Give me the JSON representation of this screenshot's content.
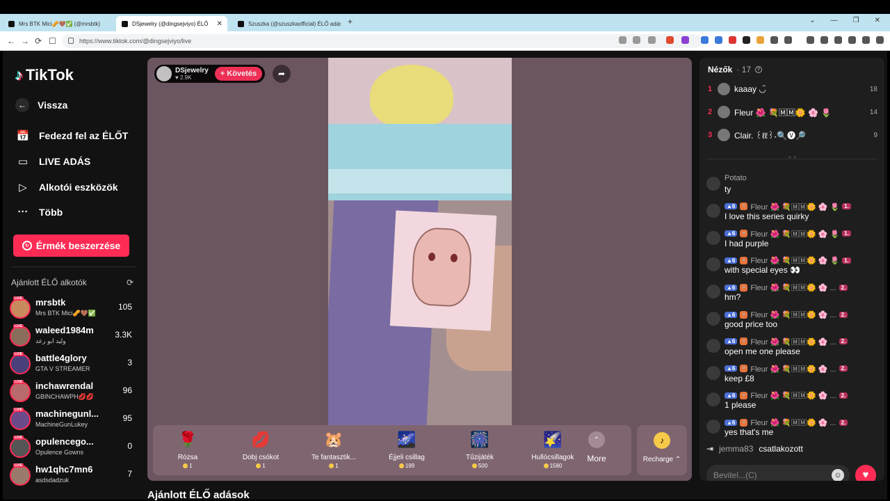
{
  "browser": {
    "tabs": [
      {
        "title": "Mrs BTK Mici🥜🤎✅ (@mrsbtk)"
      },
      {
        "title": "DSjewelry (@dingsejviyo) ÉLŐ",
        "active": true
      },
      {
        "title": "Szuszka (@szuszkaofficial) ÉLŐ adás"
      }
    ],
    "new_tab": "+",
    "url": "https://www.tiktok.com/@dingsejviyo/live"
  },
  "sidebar": {
    "logo": "TikTok",
    "back": "Vissza",
    "nav": [
      {
        "label": "Fedezd fel az ÉLŐT",
        "icon": "calendar-live-icon"
      },
      {
        "label": "LIVE ADÁS",
        "icon": "camera-icon"
      },
      {
        "label": "Alkotói eszközök",
        "icon": "play-box-icon"
      },
      {
        "label": "Több",
        "icon": "more-dots-icon"
      }
    ],
    "coins_button": "Érmék beszerzése",
    "recommended_title": "Ajánlott ÉLŐ alkotók",
    "live_badge": "LIVE",
    "creators": [
      {
        "name": "mrsbtk",
        "sub": "Mrs BTK Mici🥜🤎✅",
        "count": "105",
        "color": "#c98a5e"
      },
      {
        "name": "waleed1984m",
        "sub": "وليد ابو رعد",
        "count": "3.3K",
        "color": "#8a6d5b"
      },
      {
        "name": "battle4glory",
        "sub": "GTA V STREAMER",
        "count": "3",
        "color": "#4a3f7a"
      },
      {
        "name": "inchawrendal",
        "sub": "GBINCHAWPH💋💋",
        "count": "96",
        "color": "#b86b6b"
      },
      {
        "name": "machinegunl...",
        "sub": "MachineGunLukey",
        "count": "95",
        "color": "#6b4a8a"
      },
      {
        "name": "opulencego...",
        "sub": "Opulence Gowns",
        "count": "0",
        "color": "#555555"
      },
      {
        "name": "hw1qhc7mn6",
        "sub": "asdsdadzuk",
        "count": "7",
        "color": "#9a7a6a"
      }
    ]
  },
  "stream": {
    "host_name": "DSjewelry",
    "host_likes": "♥ 2.9K",
    "follow_label": "+ Követés",
    "gifts": [
      {
        "name": "Rózsa",
        "price": "1",
        "icon": "🌹"
      },
      {
        "name": "Dobj csókot",
        "price": "1",
        "icon": "💋"
      },
      {
        "name": "Te fantasztik...",
        "price": "1",
        "icon": "🐹"
      },
      {
        "name": "Éjjeli csillag",
        "price": "199",
        "icon": "🌌"
      },
      {
        "name": "Tűzijáték",
        "price": "500",
        "icon": "🎆"
      },
      {
        "name": "Hullócsillagok",
        "price": "1580",
        "icon": "🌠"
      }
    ],
    "more_label": "More",
    "recharge_label": "Recharge ⌃"
  },
  "recommended_live_heading": "Ajánlott ÉLŐ adások",
  "chat": {
    "viewers_title": "Nézők",
    "viewers_count": "17",
    "top_viewers": [
      {
        "rank": "1",
        "name": "kaaay ◡̈",
        "score": "18"
      },
      {
        "rank": "2",
        "name": "Fleur 🌺 💐🄼🄼🌼 🌸 🌷",
        "score": "14"
      },
      {
        "rank": "3",
        "name": "Clair. ꒰ℓℓ꒱˖🔍🅥🔎",
        "score": "9"
      }
    ],
    "messages": [
      {
        "user": "Potato",
        "text": "ty",
        "badges": false
      },
      {
        "user": "Fleur 🌺 💐🄼🄼🌼 🌸 🌷",
        "text": "I love this series quirky",
        "badges": true,
        "sub": "1."
      },
      {
        "user": "Fleur 🌺 💐🄼🄼🌼 🌸 🌷",
        "text": "I had purple",
        "badges": true,
        "sub": "1."
      },
      {
        "user": "Fleur 🌺 💐🄼🄼🌼 🌸 🌷",
        "text": "with special eyes 👀",
        "badges": true,
        "sub": "1."
      },
      {
        "user": "Fleur 🌺 💐🄼🄼🌼 🌸 ...",
        "text": "hm?",
        "badges": true,
        "sub": "2."
      },
      {
        "user": "Fleur 🌺 💐🄼🄼🌼 🌸 ...",
        "text": "good price too",
        "badges": true,
        "sub": "2."
      },
      {
        "user": "Fleur 🌺 💐🄼🄼🌼 🌸 ...",
        "text": "open me one please",
        "badges": true,
        "sub": "2."
      },
      {
        "user": "Fleur 🌺 💐🄼🄼🌼 🌸 ...",
        "text": "keep £8",
        "badges": true,
        "sub": "2."
      },
      {
        "user": "Fleur 🌺 💐🄼🄼🌼 🌸 ...",
        "text": "1 please",
        "badges": true,
        "sub": "2."
      },
      {
        "user": "Fleur 🌺 💐🄼🄼🌼 🌸 ...",
        "text": "yes that's me",
        "badges": true,
        "sub": "2."
      }
    ],
    "level_badge": "6",
    "joined_user": "jemma83",
    "joined_text": "csatlakozott",
    "input_placeholder": "Bevitel...(C)"
  },
  "colors": {
    "accent": "#fe2c55",
    "stream_bg": "#6b5560",
    "chat_bg": "#1e1e1e"
  }
}
